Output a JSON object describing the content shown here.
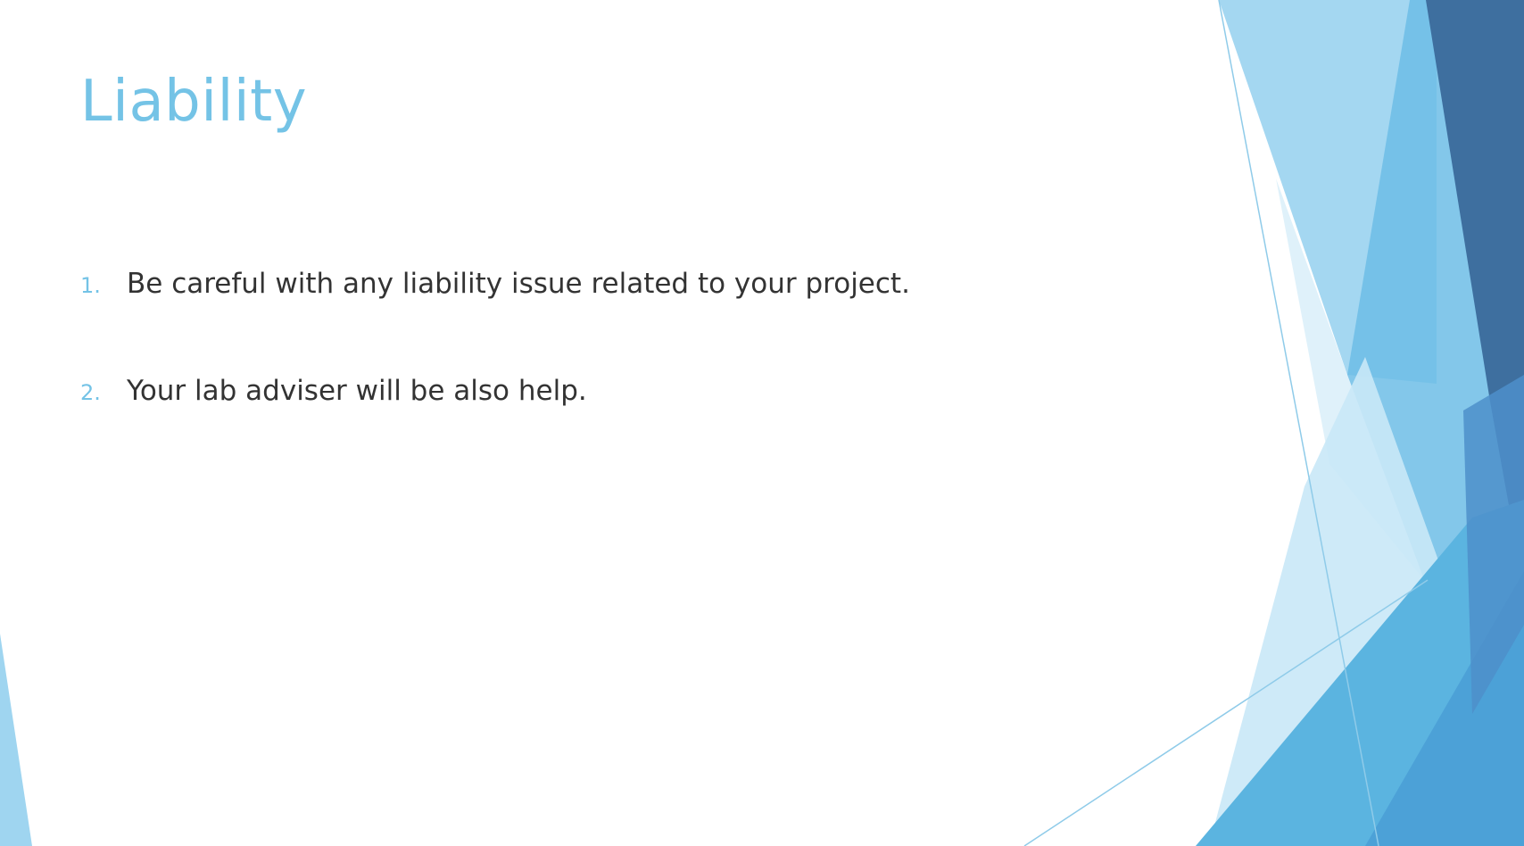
{
  "slide": {
    "title": "Liability",
    "items": [
      {
        "number": "1.",
        "text": "Be careful with any liability issue related to your project."
      },
      {
        "number": "2.",
        "text": "Your lab adviser will be also help."
      }
    ]
  },
  "colors": {
    "title": "#74c3e6",
    "number": "#74c3e6",
    "body_text": "#333333",
    "accent_light": "#9fd5f0",
    "accent_mid": "#5bb4e0",
    "accent_dark": "#3e6f9f"
  }
}
